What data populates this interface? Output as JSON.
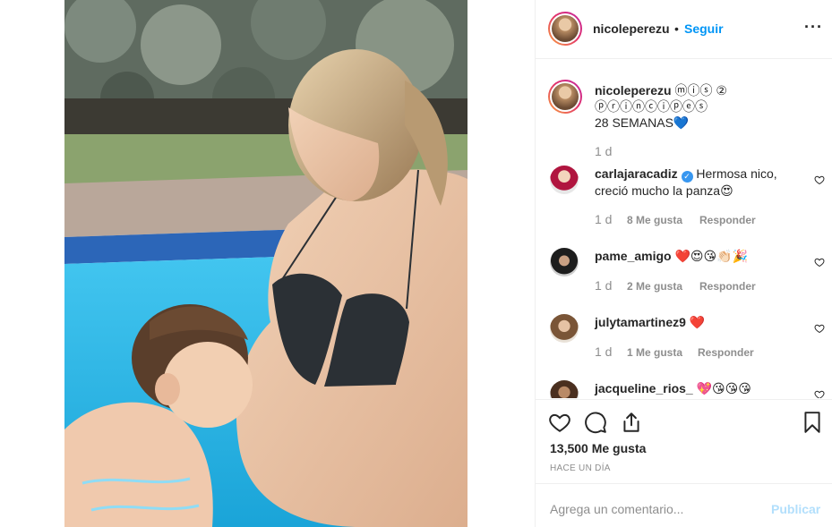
{
  "post": {
    "username": "nicoleperezu",
    "dot": "•",
    "follow_label": "Seguir",
    "more_label": "···"
  },
  "caption": {
    "username": "nicoleperezu",
    "text_line1": "ⓜⓘⓢ ②",
    "text_line2": "ⓟⓡⓘⓝⓒⓘⓟⓔⓢ",
    "text_line3": "28 SEMANAS💙",
    "time": "1 d"
  },
  "comments": [
    {
      "username": "carlajaracadiz",
      "verified": true,
      "text": "Hermosa nico, creció mucho la panza😍",
      "time": "1 d",
      "likes": "8 Me gusta",
      "reply": "Responder"
    },
    {
      "username": "pame_amigo",
      "verified": false,
      "text": "❤️😍😘👏🏻🎉",
      "time": "1 d",
      "likes": "2 Me gusta",
      "reply": "Responder"
    },
    {
      "username": "julytamartinez9",
      "verified": false,
      "text": "❤️",
      "time": "1 d",
      "likes": "1 Me gusta",
      "reply": "Responder"
    },
    {
      "username": "jacqueline_rios_",
      "verified": false,
      "text": "💖😘😘😘",
      "time": "",
      "likes": "",
      "reply": ""
    }
  ],
  "actions": {
    "icons": [
      "heart-icon",
      "comment-icon",
      "share-icon",
      "bookmark-icon"
    ],
    "likes_count": "13,500 Me gusta",
    "posted_ago": "HACE UN DÍA"
  },
  "add_comment": {
    "placeholder": "Agrega un comentario...",
    "post_label": "Publicar"
  },
  "colors": {
    "accent": "#0095f6",
    "post_disabled": "#b2dffc",
    "muted": "#8e8e8e",
    "verified": "#3897f0",
    "pool": "#29b6e8"
  }
}
